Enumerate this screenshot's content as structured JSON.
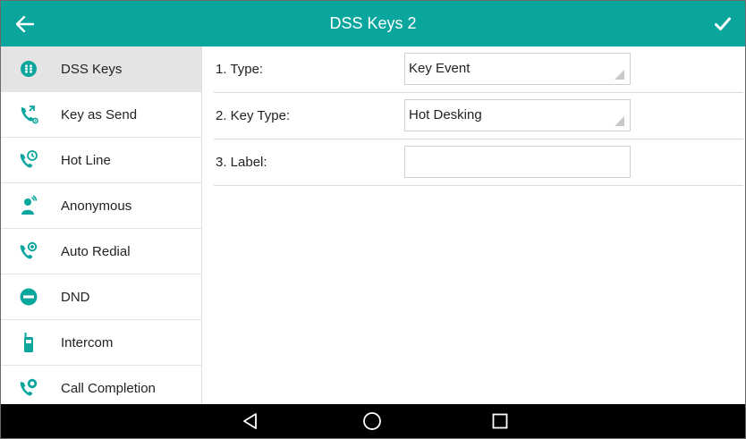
{
  "header": {
    "title": "DSS Keys 2",
    "back_icon": "arrow-left-icon",
    "save_icon": "checkmark-icon"
  },
  "colors": {
    "accent": "#0aa59c",
    "sidebar_active": "#e4e4e4",
    "navbar": "#000000"
  },
  "sidebar": {
    "items": [
      {
        "label": "DSS Keys",
        "icon": "dss-keys-icon",
        "active": true
      },
      {
        "label": "Key as Send",
        "icon": "key-as-send-icon"
      },
      {
        "label": "Hot Line",
        "icon": "hot-line-icon"
      },
      {
        "label": "Anonymous",
        "icon": "anonymous-icon"
      },
      {
        "label": "Auto Redial",
        "icon": "auto-redial-icon"
      },
      {
        "label": "DND",
        "icon": "dnd-icon"
      },
      {
        "label": "Intercom",
        "icon": "intercom-icon"
      },
      {
        "label": "Call Completion",
        "icon": "call-completion-icon"
      }
    ]
  },
  "form": {
    "type": {
      "label": "1. Type:",
      "value": "Key Event"
    },
    "key_type": {
      "label": "2. Key Type:",
      "value": "Hot Desking"
    },
    "label": {
      "label": "3. Label:",
      "value": ""
    }
  },
  "navbar": {
    "icons": [
      "back-triangle-icon",
      "home-circle-icon",
      "recents-square-icon"
    ]
  }
}
